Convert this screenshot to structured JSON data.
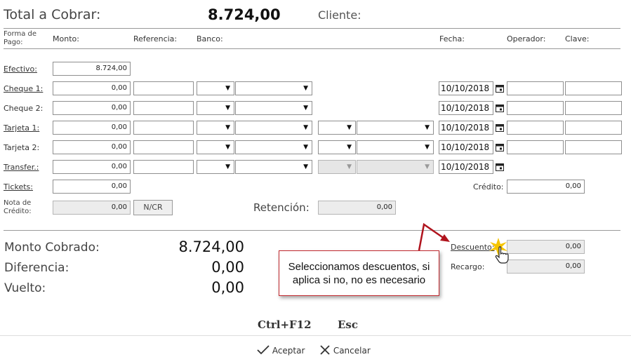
{
  "header": {
    "total_label": "Total a Cobrar:",
    "total_value": "8.724,00",
    "cliente_label": "Cliente:"
  },
  "columns": {
    "forma_de_pago": "Forma de Pago:",
    "monto": "Monto:",
    "referencia": "Referencia:",
    "banco": "Banco:",
    "fecha": "Fecha:",
    "operador": "Operador:",
    "clave": "Clave:"
  },
  "rows": {
    "efectivo": {
      "label": "Efectivo:",
      "monto": "8.724,00"
    },
    "cheque1": {
      "label": "Cheque 1:",
      "monto": "0,00",
      "fecha": "10/10/2018"
    },
    "cheque2": {
      "label": "Cheque 2:",
      "monto": "0,00",
      "fecha": "10/10/2018"
    },
    "tarjeta1": {
      "label": "Tarjeta 1:",
      "monto": "0,00",
      "fecha": "10/10/2018"
    },
    "tarjeta2": {
      "label": "Tarjeta 2:",
      "monto": "0,00",
      "fecha": "10/10/2018"
    },
    "transfer": {
      "label": "Transfer.:",
      "monto": "0,00",
      "fecha": "10/10/2018"
    },
    "tickets": {
      "label": "Tickets:",
      "monto": "0,00"
    },
    "nota_credito": {
      "label": "Nota de Crédito:",
      "monto": "0,00",
      "button": "N/CR"
    }
  },
  "credito": {
    "label": "Crédito:",
    "value": "0,00"
  },
  "retencion": {
    "label": "Retención:",
    "value": "0,00"
  },
  "summary": {
    "monto_cobrado_label": "Monto Cobrado:",
    "monto_cobrado_value": "8.724,00",
    "diferencia_label": "Diferencia:",
    "diferencia_value": "0,00",
    "vuelto_label": "Vuelto:",
    "vuelto_value": "0,00"
  },
  "descuento": {
    "label": "Descuento:",
    "value": "0,00"
  },
  "recargo": {
    "label": "Recargo:",
    "value": "0,00"
  },
  "callout": {
    "text": "Seleccionamos descuentos, si aplica si no, no es necesario"
  },
  "shortcuts": {
    "ctrl_f12": "Ctrl+F12",
    "esc": "Esc"
  },
  "footer": {
    "accept": "Aceptar",
    "cancel": "Cancelar"
  },
  "colors": {
    "callout_border": "#c0272d",
    "arrow": "#b0141e",
    "highlight": "#f5c400"
  }
}
